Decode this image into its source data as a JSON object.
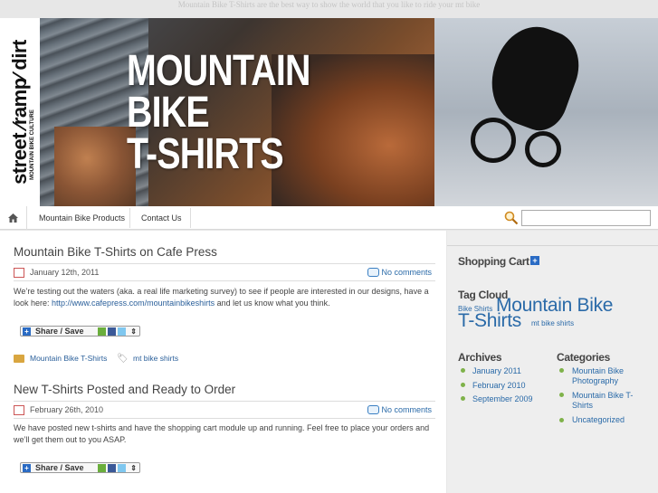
{
  "site": {
    "tagline": "Mountain Bike T-Shirts are the best way to show the world that you like to ride your mt bike",
    "title_lines": [
      "MOUNTAIN",
      "BIKE",
      "T-SHIRTS"
    ],
    "logo_text": "street ∕ramp∕ dirt",
    "logo_sub": "MOUNTAIN BIKE CULTURE"
  },
  "nav": {
    "items": [
      "Mountain Bike Products",
      "Contact Us"
    ],
    "search_placeholder": ""
  },
  "posts": [
    {
      "title": "Mountain Bike T-Shirts on Cafe Press",
      "date": "January 12th, 2011",
      "comments": "No comments",
      "body_before": "We’re testing out the waters (aka. a real life marketing survey) to see if people are interested in our designs, have a look here: ",
      "link": "http://www.cafepress.com/mountainbikeshirts",
      "body_after": " and let us know what you think.",
      "share_label": "Share / Save",
      "category": "Mountain Bike T-Shirts",
      "tag": "mt bike shirts"
    },
    {
      "title": "New T-Shirts Posted and Ready to Order",
      "date": "February 26th, 2010",
      "comments": "No comments",
      "body": "We have posted new t-shirts and have the shopping cart module up and running. Feel free to place your orders and we’ll get them out to you ASAP.",
      "share_label": "Share / Save"
    }
  ],
  "sidebar": {
    "cart_heading": "Shopping Cart",
    "cart_plus": "+",
    "tagcloud_heading": "Tag Cloud",
    "tags": [
      {
        "label": "Bike Shirts",
        "size": "small"
      },
      {
        "label": "Mountain Bike",
        "size": "large"
      },
      {
        "label": "T-Shirts",
        "size": "large"
      },
      {
        "label": "mt bike shirts",
        "size": "small"
      }
    ],
    "archives_heading": "Archives",
    "archives": [
      "January 2011",
      "February 2010",
      "September 2009"
    ],
    "categories_heading": "Categories",
    "categories": [
      "Mountain Bike Photography",
      "Mountain Bike T-Shirts",
      "Uncategorized"
    ]
  },
  "colors": {
    "link": "#2a6aa8",
    "bullet": "#7fb24a",
    "accent_blue": "#2a6bc4"
  }
}
